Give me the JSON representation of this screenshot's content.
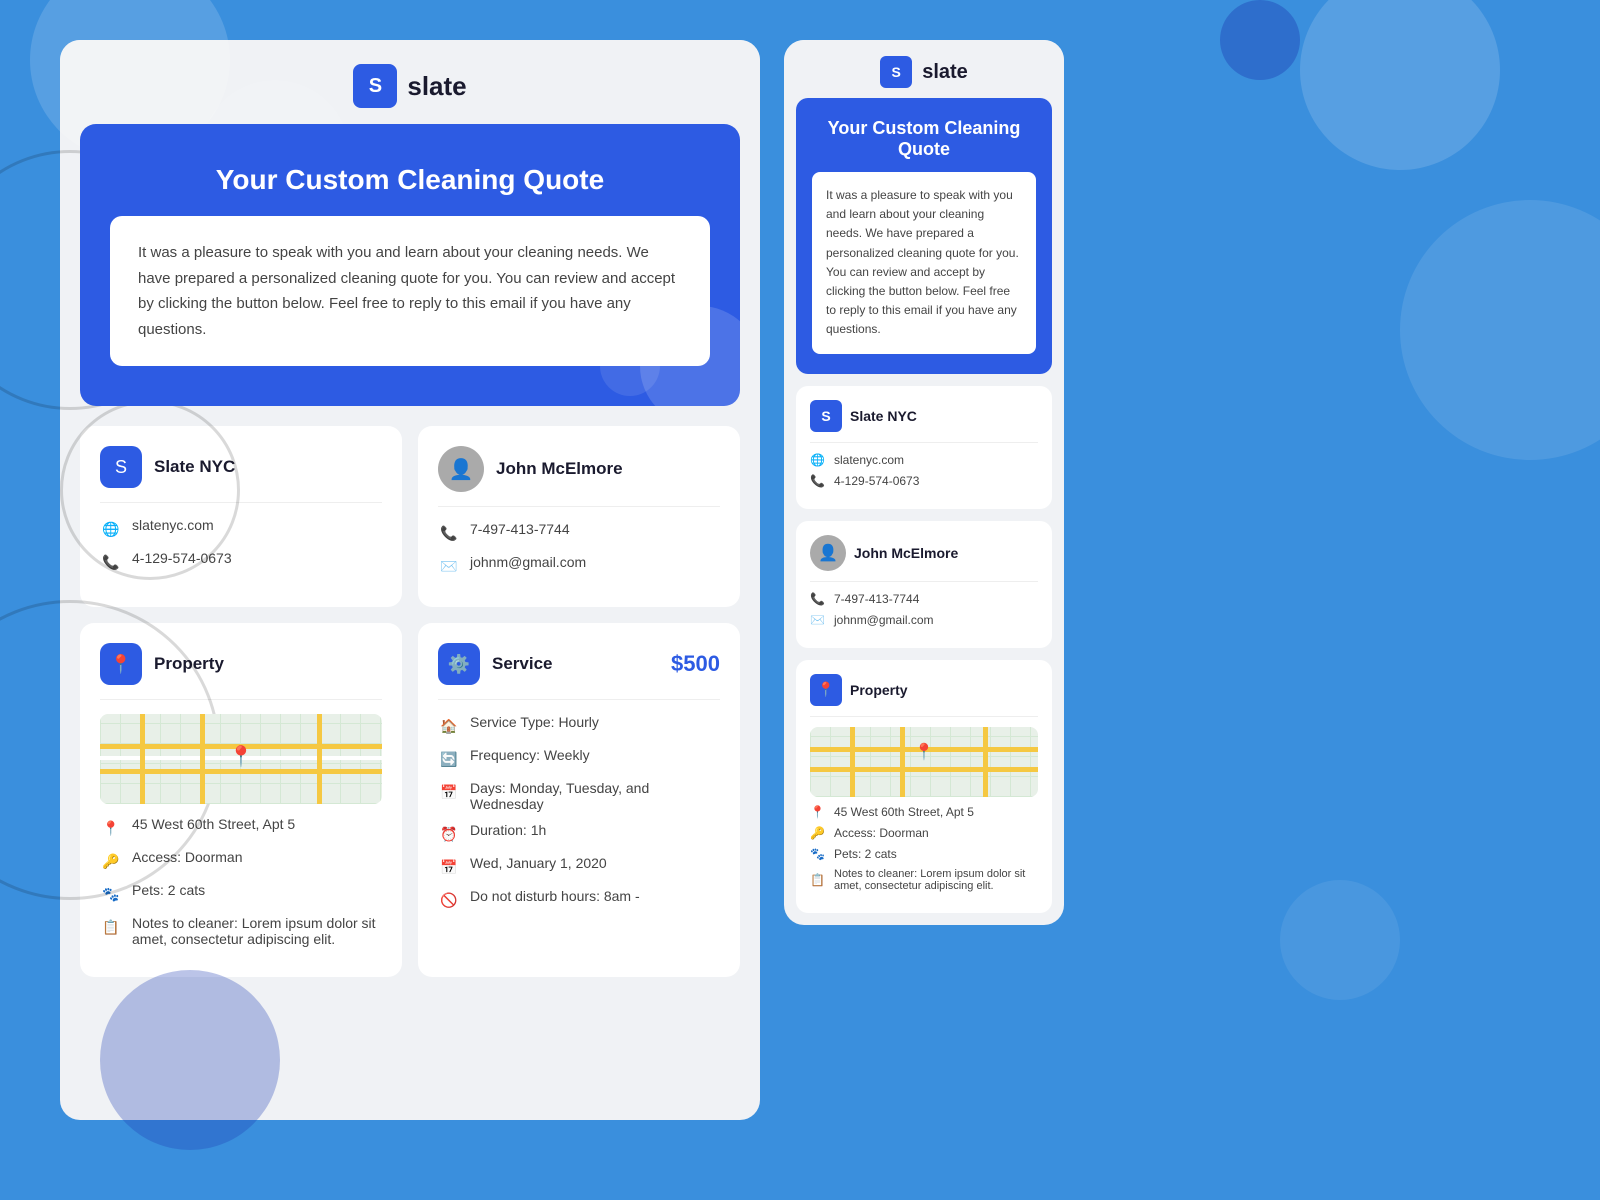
{
  "brand": {
    "name": "slate",
    "logo_letter": "S",
    "company_name": "Slate NYC",
    "website": "slatenyc.com",
    "phone": "4-129-574-0673"
  },
  "quote": {
    "title": "Your Custom Cleaning Quote",
    "intro_text": "It was a pleasure to speak with you and learn about your cleaning needs. We have prepared a personalized cleaning quote for you. You can review and accept by clicking the button below.  Feel free to reply to this email if you have any questions.",
    "intro_text_short": "It was a pleasure to speak with you and learn about your cleaning needs. We have prepared a personalized cleaning quote for you. You can review and accept by clicking the button below.  Feel free to reply to this email if you have any questions."
  },
  "client": {
    "name": "John McElmore",
    "phone": "7-497-413-7744",
    "email": "johnm@gmail.com"
  },
  "property": {
    "label": "Property",
    "address": "45 West 60th Street, Apt 5",
    "access": "Access: Doorman",
    "pets": "Pets: 2 cats",
    "notes": "Notes to cleaner: Lorem ipsum dolor sit amet, consectetur adipiscing elit."
  },
  "service": {
    "label": "Service",
    "price": "$500",
    "type": "Service Type: Hourly",
    "frequency": "Frequency: Weekly",
    "days": "Days: Monday, Tuesday, and Wednesday",
    "duration": "Duration: 1h",
    "date": "Wed, January 1, 2020",
    "disturb": "Do not disturb hours: 8am -"
  },
  "icons": {
    "globe": "🌐",
    "phone": "📞",
    "location": "📍",
    "key": "🔑",
    "paw": "🐾",
    "notes": "📋",
    "gear": "⚙️",
    "calendar": "📅",
    "clock": "⏰",
    "repeat": "🔄",
    "ban": "🚫"
  }
}
